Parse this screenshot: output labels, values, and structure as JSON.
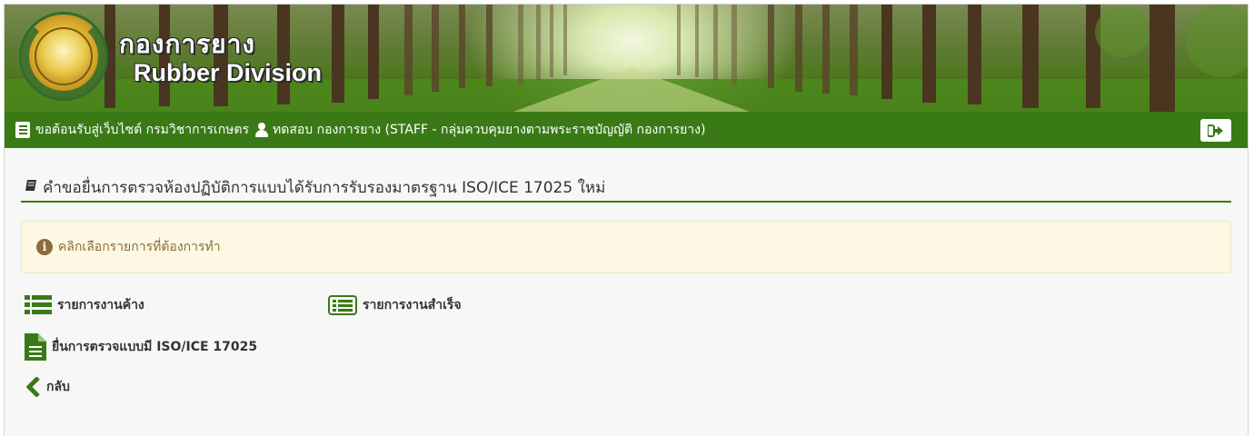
{
  "banner": {
    "brand_thai": "กองการยาง",
    "brand_en": "Rubber Division"
  },
  "navbar": {
    "welcome": "ขอต้อนรับสู่เว็บไซต์ กรมวิชาการเกษตร",
    "user": "ทดสอบ กองการยาง (STAFF - กลุ่มควบคุมยางตามพระราชบัญญัติ กองการยาง)"
  },
  "page": {
    "title": "คำขอยื่นการตรวจห้องปฏิบัติการแบบได้รับการรับรองมาตรฐาน ISO/ICE 17025 ใหม่",
    "alert": "คลิกเลือกรายการที่ต้องการทำ"
  },
  "actions": {
    "pending": "รายการงานค้าง",
    "completed": "รายการงานสำเร็จ",
    "submit": "ยื่นการตรวจแบบมี ISO/ICE 17025",
    "back": "กลับ"
  },
  "colors": {
    "nav_green": "#3a7a16",
    "alert_bg": "#fcf8e3",
    "alert_text": "#8a6d3b",
    "icon_green": "#3a7a16"
  }
}
